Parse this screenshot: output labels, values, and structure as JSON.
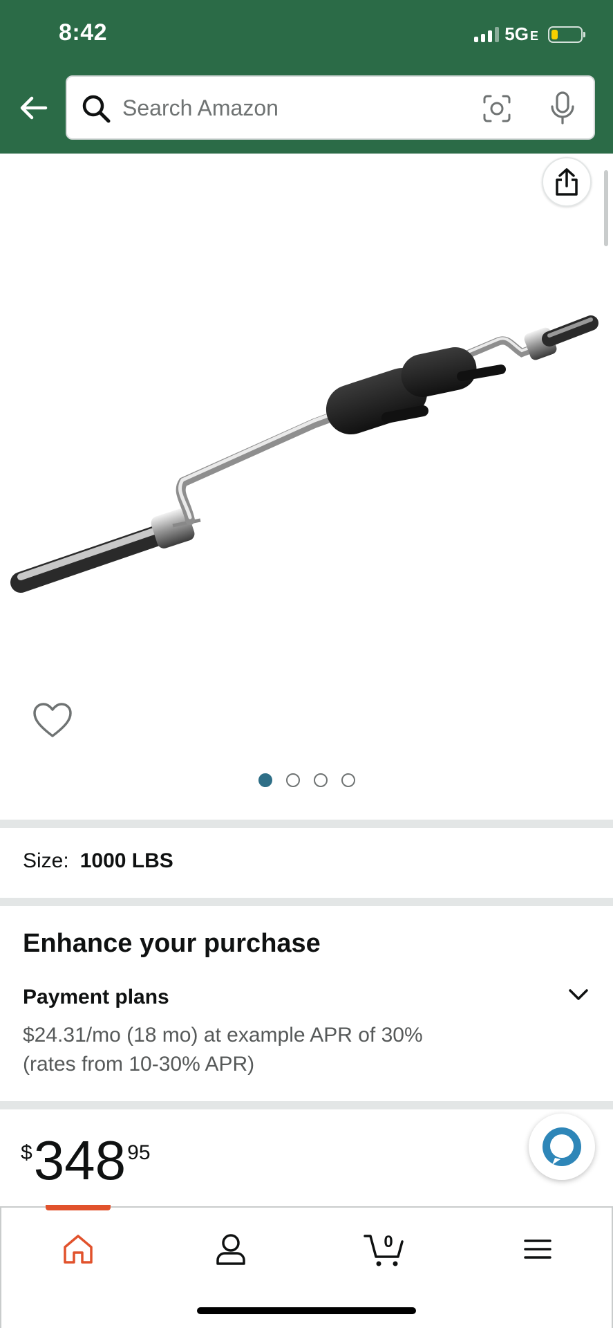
{
  "status_bar": {
    "time": "8:42",
    "network": "5G",
    "network_suffix": "E"
  },
  "search": {
    "placeholder": "Search Amazon"
  },
  "gallery": {
    "page_count": 4,
    "active_page": 1
  },
  "product": {
    "size_label": "Size:",
    "size_value": "1000 LBS",
    "enhance_title": "Enhance your purchase",
    "payment_title": "Payment plans",
    "payment_line1": "$24.31/mo (18 mo) at example APR of 30%",
    "payment_line2": "(rates from 10-30% APR)",
    "price_symbol": "$",
    "price_whole": "348",
    "price_fraction": "95"
  },
  "nav": {
    "cart_count": "0",
    "active_tab": "home"
  },
  "colors": {
    "header": "#2b6b47",
    "accent": "#e1522c",
    "dot_active": "#2f6f87",
    "alexa": "#2e86b8"
  }
}
